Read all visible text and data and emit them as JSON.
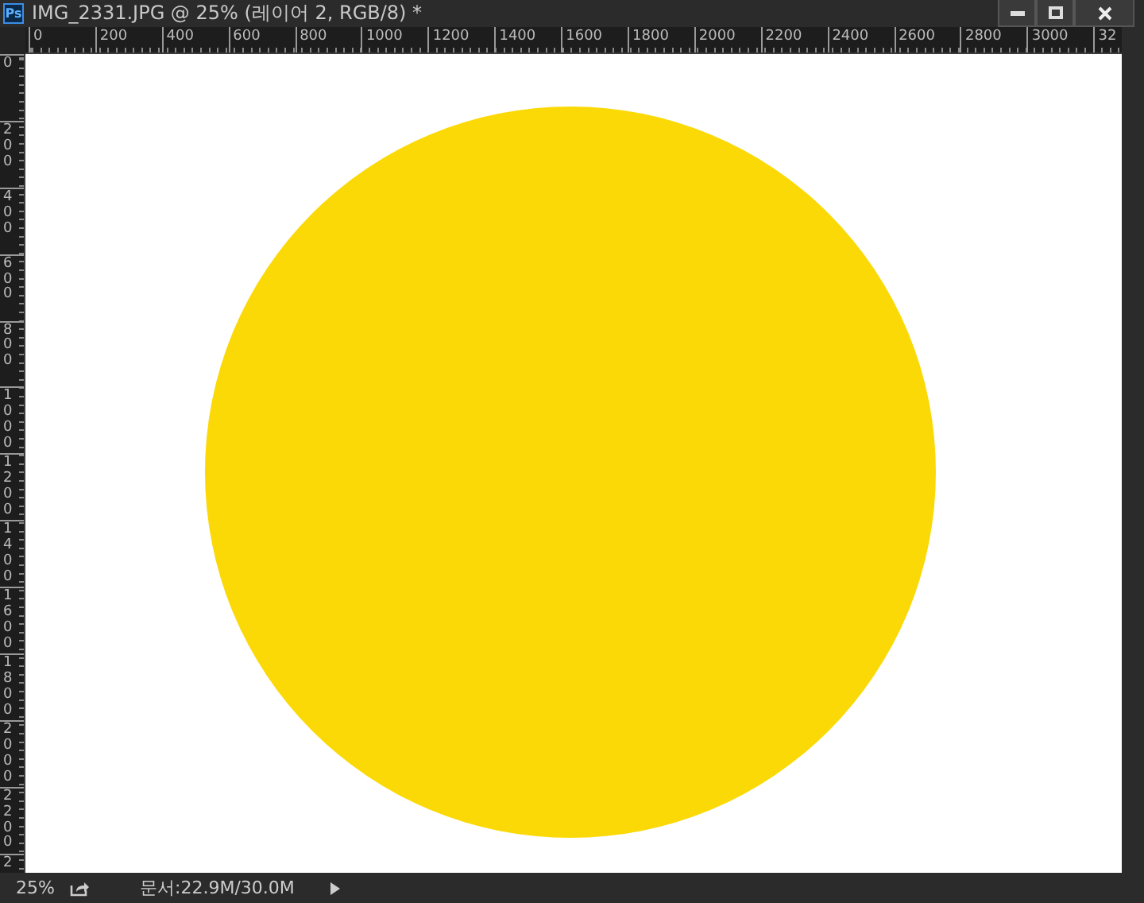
{
  "window": {
    "app_badge": "Ps",
    "title": "IMG_2331.JPG @ 25% (레이어 2, RGB/8) *"
  },
  "horizontal_ruler": {
    "labels": [
      "0",
      "200",
      "400",
      "600",
      "800",
      "1000",
      "1200",
      "1400",
      "1600",
      "1800",
      "2000",
      "2200",
      "2400",
      "2600",
      "2800",
      "3000",
      "32"
    ]
  },
  "vertical_ruler": {
    "labels": [
      "0",
      "200",
      "400",
      "600",
      "800",
      "1000",
      "1200",
      "1400",
      "1600",
      "1800",
      "2000",
      "2200",
      "2"
    ]
  },
  "status_bar": {
    "zoom": "25%",
    "document_size": "문서:22.9M/30.0M"
  }
}
